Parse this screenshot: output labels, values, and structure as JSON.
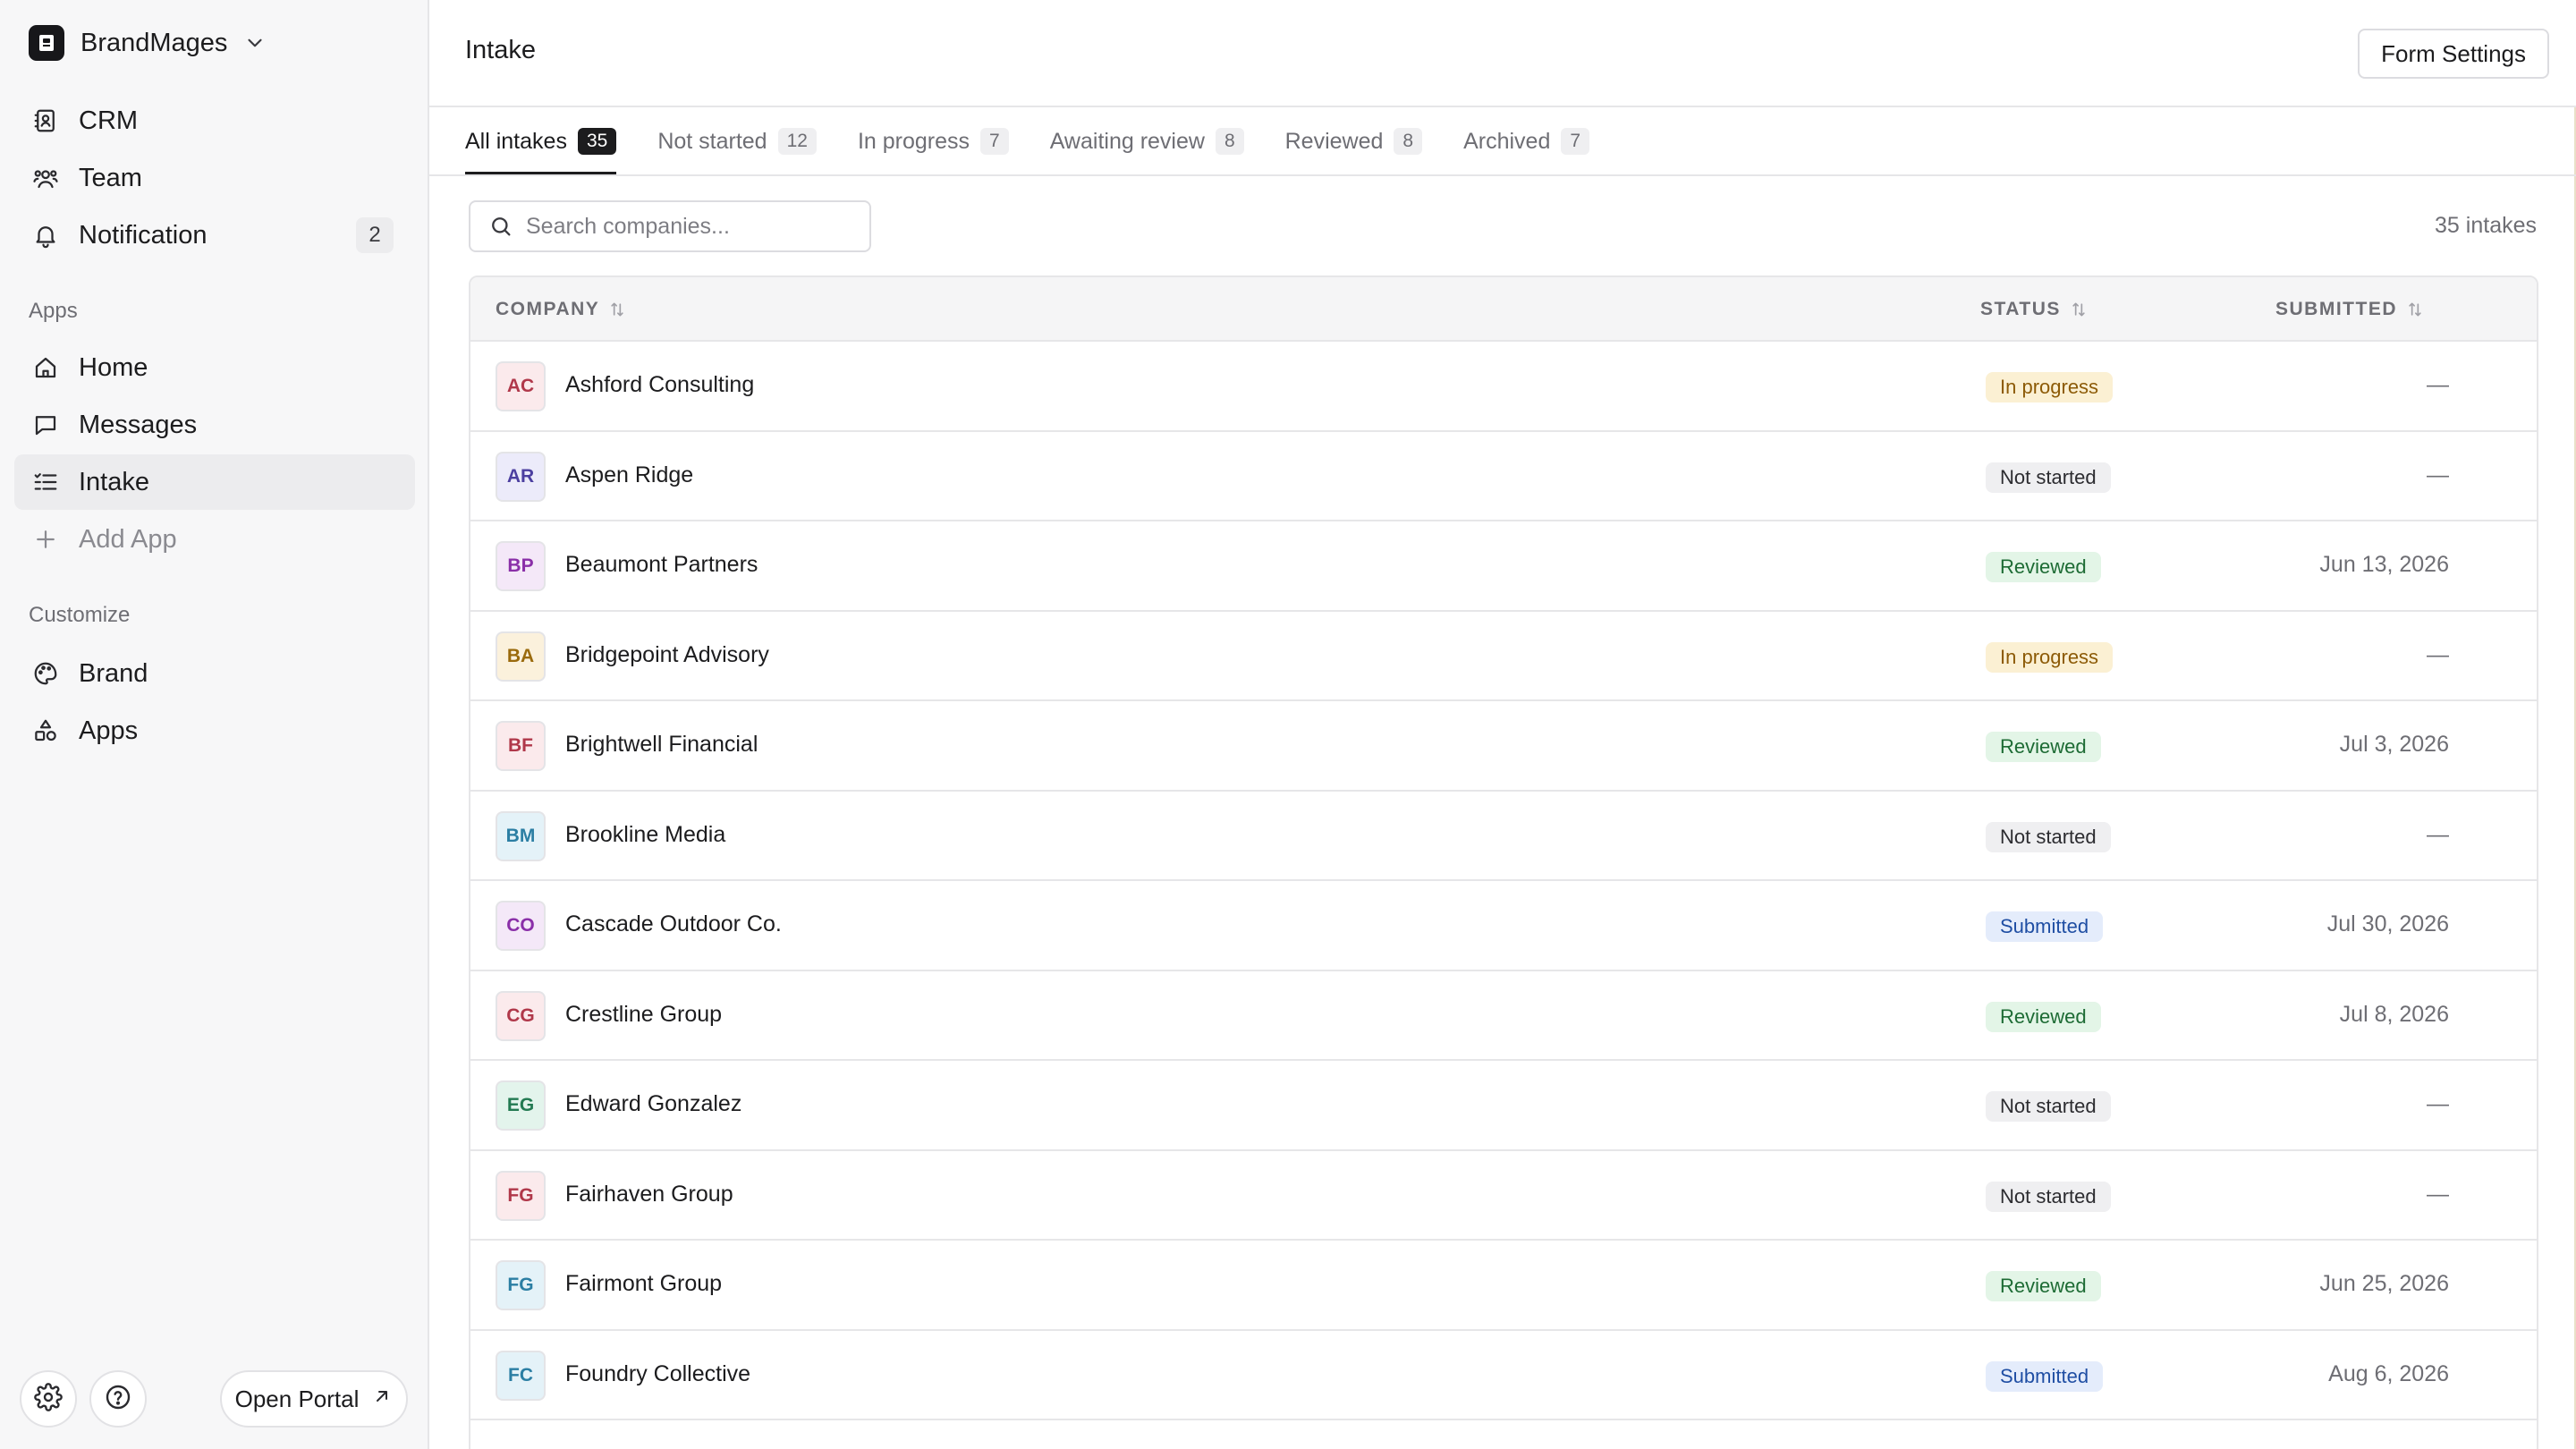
{
  "workspace": {
    "name": "BrandMages"
  },
  "sidebar": {
    "nav": [
      {
        "label": "CRM",
        "icon": "contacts-book-icon"
      },
      {
        "label": "Team",
        "icon": "team-icon"
      },
      {
        "label": "Notification",
        "icon": "bell-icon",
        "badge": "2"
      }
    ],
    "apps_label": "Apps",
    "apps": [
      {
        "label": "Home",
        "icon": "home-icon"
      },
      {
        "label": "Messages",
        "icon": "message-icon"
      },
      {
        "label": "Intake",
        "icon": "list-check-icon",
        "active": true
      },
      {
        "label": "Add App",
        "icon": "plus-icon"
      }
    ],
    "customize_label": "Customize",
    "customize": [
      {
        "label": "Brand",
        "icon": "palette-icon"
      },
      {
        "label": "Apps",
        "icon": "shapes-icon"
      }
    ],
    "open_portal_label": "Open Portal"
  },
  "header": {
    "title": "Intake",
    "form_settings_label": "Form Settings"
  },
  "tabs": [
    {
      "label": "All intakes",
      "count": "35",
      "active": true
    },
    {
      "label": "Not started",
      "count": "12"
    },
    {
      "label": "In progress",
      "count": "7"
    },
    {
      "label": "Awaiting review",
      "count": "8"
    },
    {
      "label": "Reviewed",
      "count": "8"
    },
    {
      "label": "Archived",
      "count": "7"
    }
  ],
  "search": {
    "placeholder": "Search companies...",
    "value": ""
  },
  "intake_count_text": "35 intakes",
  "table": {
    "columns": {
      "company": "COMPANY",
      "status": "STATUS",
      "submitted": "SUBMITTED"
    },
    "rows": [
      {
        "initials": "AC",
        "company": "Ashford Consulting",
        "status": "In progress",
        "submitted": "—",
        "avatar_bg": "#fbeaec",
        "avatar_fg": "#b0384a"
      },
      {
        "initials": "AR",
        "company": "Aspen Ridge",
        "status": "Not started",
        "submitted": "—",
        "avatar_bg": "#ecebfa",
        "avatar_fg": "#4c3fa0"
      },
      {
        "initials": "BP",
        "company": "Beaumont Partners",
        "status": "Reviewed",
        "submitted": "Jun 13, 2026",
        "avatar_bg": "#f4e8f8",
        "avatar_fg": "#8a2fa8"
      },
      {
        "initials": "BA",
        "company": "Bridgepoint Advisory",
        "status": "In progress",
        "submitted": "—",
        "avatar_bg": "#fbf1dc",
        "avatar_fg": "#9a6a0c"
      },
      {
        "initials": "BF",
        "company": "Brightwell Financial",
        "status": "Reviewed",
        "submitted": "Jul 3, 2026",
        "avatar_bg": "#fbeaec",
        "avatar_fg": "#b0384a"
      },
      {
        "initials": "BM",
        "company": "Brookline Media",
        "status": "Not started",
        "submitted": "—",
        "avatar_bg": "#e4f2f8",
        "avatar_fg": "#2b7ea3"
      },
      {
        "initials": "CO",
        "company": "Cascade Outdoor Co.",
        "status": "Submitted",
        "submitted": "Jul 30, 2026",
        "avatar_bg": "#f4e8f8",
        "avatar_fg": "#8a2fa8"
      },
      {
        "initials": "CG",
        "company": "Crestline Group",
        "status": "Reviewed",
        "submitted": "Jul 8, 2026",
        "avatar_bg": "#fbeaec",
        "avatar_fg": "#b0384a"
      },
      {
        "initials": "EG",
        "company": "Edward Gonzalez",
        "status": "Not started",
        "submitted": "—",
        "avatar_bg": "#e3f4ec",
        "avatar_fg": "#237a52"
      },
      {
        "initials": "FG",
        "company": "Fairhaven Group",
        "status": "Not started",
        "submitted": "—",
        "avatar_bg": "#fbeaec",
        "avatar_fg": "#b0384a"
      },
      {
        "initials": "FG",
        "company": "Fairmont Group",
        "status": "Reviewed",
        "submitted": "Jun 25, 2026",
        "avatar_bg": "#e4f2f8",
        "avatar_fg": "#2b7ea3"
      },
      {
        "initials": "FC",
        "company": "Foundry Collective",
        "status": "Submitted",
        "submitted": "Aug 6, 2026",
        "avatar_bg": "#e4f2f8",
        "avatar_fg": "#2b7ea3"
      }
    ]
  }
}
